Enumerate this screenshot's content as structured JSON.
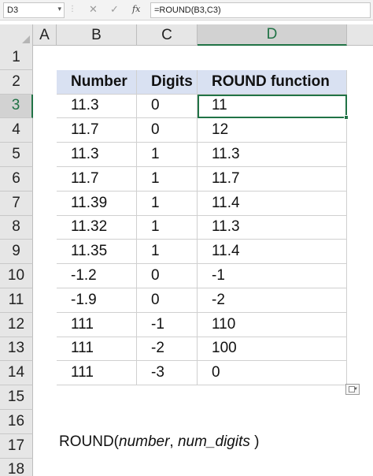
{
  "formula_bar": {
    "name_box": "D3",
    "cancel_glyph": "✕",
    "enter_glyph": "✓",
    "fx_label": "fx",
    "formula": "=ROUND(B3,C3)"
  },
  "columns": [
    "A",
    "B",
    "C",
    "D"
  ],
  "active_column": "D",
  "rows": [
    "1",
    "2",
    "3",
    "4",
    "5",
    "6",
    "7",
    "8",
    "9",
    "10",
    "11",
    "12",
    "13",
    "14",
    "15",
    "16",
    "17",
    "18"
  ],
  "active_row": "3",
  "table": {
    "headers": [
      "Number",
      "Digits",
      "ROUND function"
    ],
    "rows": [
      [
        "11.3",
        "0",
        "11"
      ],
      [
        "11.7",
        "0",
        "12"
      ],
      [
        "11.3",
        "1",
        "11.3"
      ],
      [
        "11.7",
        "1",
        "11.7"
      ],
      [
        "11.39",
        "1",
        "11.4"
      ],
      [
        "11.32",
        "1",
        "11.3"
      ],
      [
        "11.35",
        "1",
        "11.4"
      ],
      [
        "-1.2",
        "0",
        "-1"
      ],
      [
        "-1.9",
        "0",
        "-2"
      ],
      [
        "111",
        "-1",
        "110"
      ],
      [
        "111",
        "-2",
        "100"
      ],
      [
        "111",
        "-3",
        "0"
      ]
    ],
    "header_fill": "#d9e1f2"
  },
  "syntax": {
    "func": "ROUND(",
    "arg1": "number",
    "sep": ", ",
    "arg2": "num_digits",
    "close": " )"
  },
  "colors": {
    "accent": "#217346",
    "header_bg": "#e6e6e6",
    "grid": "#d0d0d0"
  },
  "icons": {
    "paste_options": "paste-options-icon",
    "select_all": "select-all-triangle-icon"
  }
}
